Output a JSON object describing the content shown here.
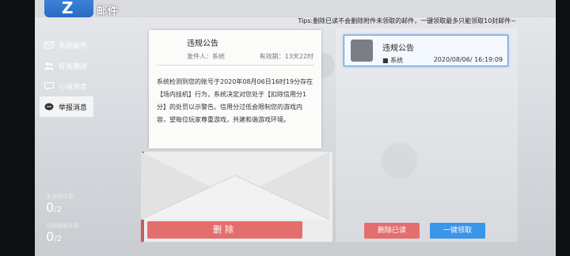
{
  "header": {
    "logo_glyph": "Z",
    "title": "邮件"
  },
  "tips": "Tips:删除已读不会删除附件未领取的邮件，一键领取最多只能领取10封邮件~",
  "sidebar": {
    "items": [
      {
        "label": "系统邮件",
        "icon": "envelope-icon"
      },
      {
        "label": "好友赠送",
        "icon": "friends-icon"
      },
      {
        "label": "小道消息",
        "icon": "chat-icon"
      },
      {
        "label": "举报消息",
        "icon": "report-icon"
      }
    ],
    "active_index": 3
  },
  "counts": {
    "unread_label": "未读邮件数",
    "unread_value": "0",
    "unread_total": "2",
    "claimable_label": "可领取邮件数",
    "claimable_value": "0",
    "claimable_total": "2"
  },
  "letter": {
    "title": "违规公告",
    "sender": "发件人：系统",
    "expiry": "有效期：13天22时",
    "body": "系统检测到您的账号于2020年08月06日16时19分存在【场内挂机】行为，系统决定对您处于【扣除信用分1分】的处罚以示警告。信用分过低会限制您的游戏内容，望每位玩家尊重游戏，共建和谐游戏环境。",
    "delete_label": "删除"
  },
  "mail_list": [
    {
      "title": "违规公告",
      "sender": "系统",
      "date": "2020/08/06/ 16:19:09"
    }
  ],
  "buttons": {
    "delete_read": "删除已读",
    "claim_all": "一键领取"
  },
  "colors": {
    "accent_blue": "#3b82d6",
    "delete_red": "#e46e6e",
    "claim_blue": "#3b95e8"
  }
}
